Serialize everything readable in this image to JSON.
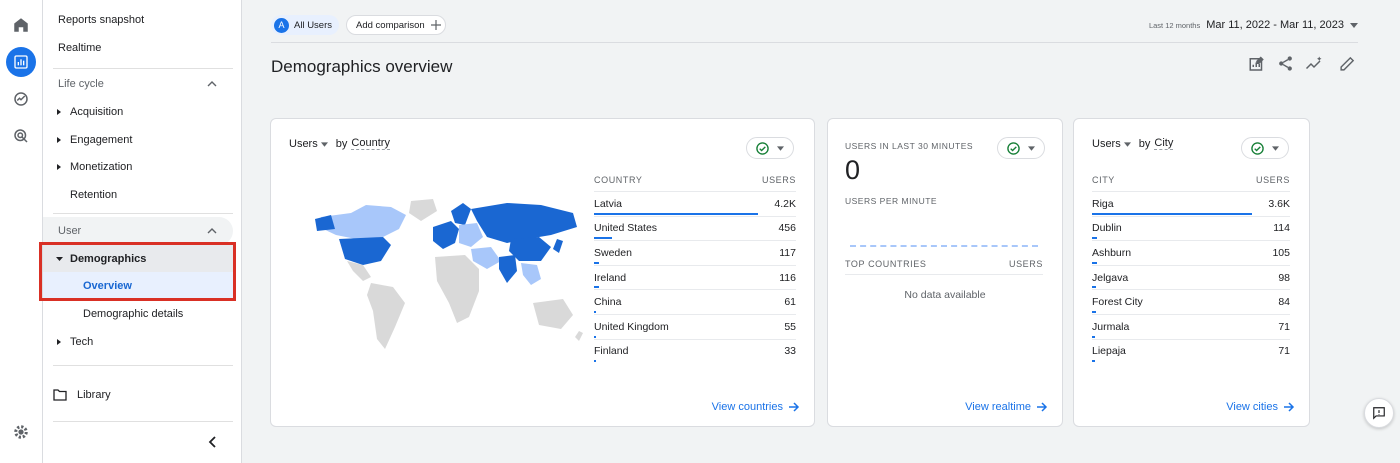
{
  "left_rail": {
    "icons": [
      "home-icon",
      "reports-icon",
      "explore-icon",
      "advertising-icon",
      "settings-icon"
    ]
  },
  "nav": {
    "reports_snapshot": "Reports snapshot",
    "realtime": "Realtime",
    "lifecycle_header": "Life cycle",
    "acquisition": "Acquisition",
    "engagement": "Engagement",
    "monetization": "Monetization",
    "retention": "Retention",
    "user_header": "User",
    "demographics": "Demographics",
    "overview": "Overview",
    "demographic_details": "Demographic details",
    "tech": "Tech",
    "library": "Library"
  },
  "top": {
    "segment_avatar": "A",
    "segment_label": "All Users",
    "add_comparison": "Add comparison",
    "range_label": "Last 12 months",
    "range_value": "Mar 11, 2022 - Mar 11, 2023"
  },
  "page_title": "Demographics overview",
  "country_card": {
    "metric": "Users",
    "by_label": "by",
    "dimension": "Country",
    "col_dim": "COUNTRY",
    "col_metric": "USERS",
    "rows": [
      {
        "name": "Latvia",
        "value": "4.2K",
        "fraction": 1.0
      },
      {
        "name": "United States",
        "value": "456",
        "fraction": 0.108
      },
      {
        "name": "Sweden",
        "value": "117",
        "fraction": 0.028
      },
      {
        "name": "Ireland",
        "value": "116",
        "fraction": 0.028
      },
      {
        "name": "China",
        "value": "61",
        "fraction": 0.015
      },
      {
        "name": "United Kingdom",
        "value": "55",
        "fraction": 0.013
      },
      {
        "name": "Finland",
        "value": "33",
        "fraction": 0.008
      }
    ],
    "link": "View countries"
  },
  "realtime_card": {
    "header": "USERS IN LAST 30 MINUTES",
    "count": "0",
    "per_minute": "USERS PER MINUTE",
    "top_countries": "TOP COUNTRIES",
    "users_col": "USERS",
    "empty": "No data available",
    "link": "View realtime"
  },
  "city_card": {
    "metric": "Users",
    "by_label": "by",
    "dimension": "City",
    "col_dim": "CITY",
    "col_metric": "USERS",
    "rows": [
      {
        "name": "Riga",
        "value": "3.6K",
        "fraction": 1.0
      },
      {
        "name": "Dublin",
        "value": "114",
        "fraction": 0.032
      },
      {
        "name": "Ashburn",
        "value": "105",
        "fraction": 0.029
      },
      {
        "name": "Jelgava",
        "value": "98",
        "fraction": 0.027
      },
      {
        "name": "Forest City",
        "value": "84",
        "fraction": 0.023
      },
      {
        "name": "Jurmala",
        "value": "71",
        "fraction": 0.02
      },
      {
        "name": "Liepaja",
        "value": "71",
        "fraction": 0.02
      }
    ],
    "link": "View cities"
  },
  "colors": {
    "accent": "#1a73e8",
    "map_dark": "#1a67d2",
    "map_light": "#a8c7fa",
    "map_grey": "#d9d9d9",
    "status_green": "#188038",
    "highlight": "#d93025"
  }
}
